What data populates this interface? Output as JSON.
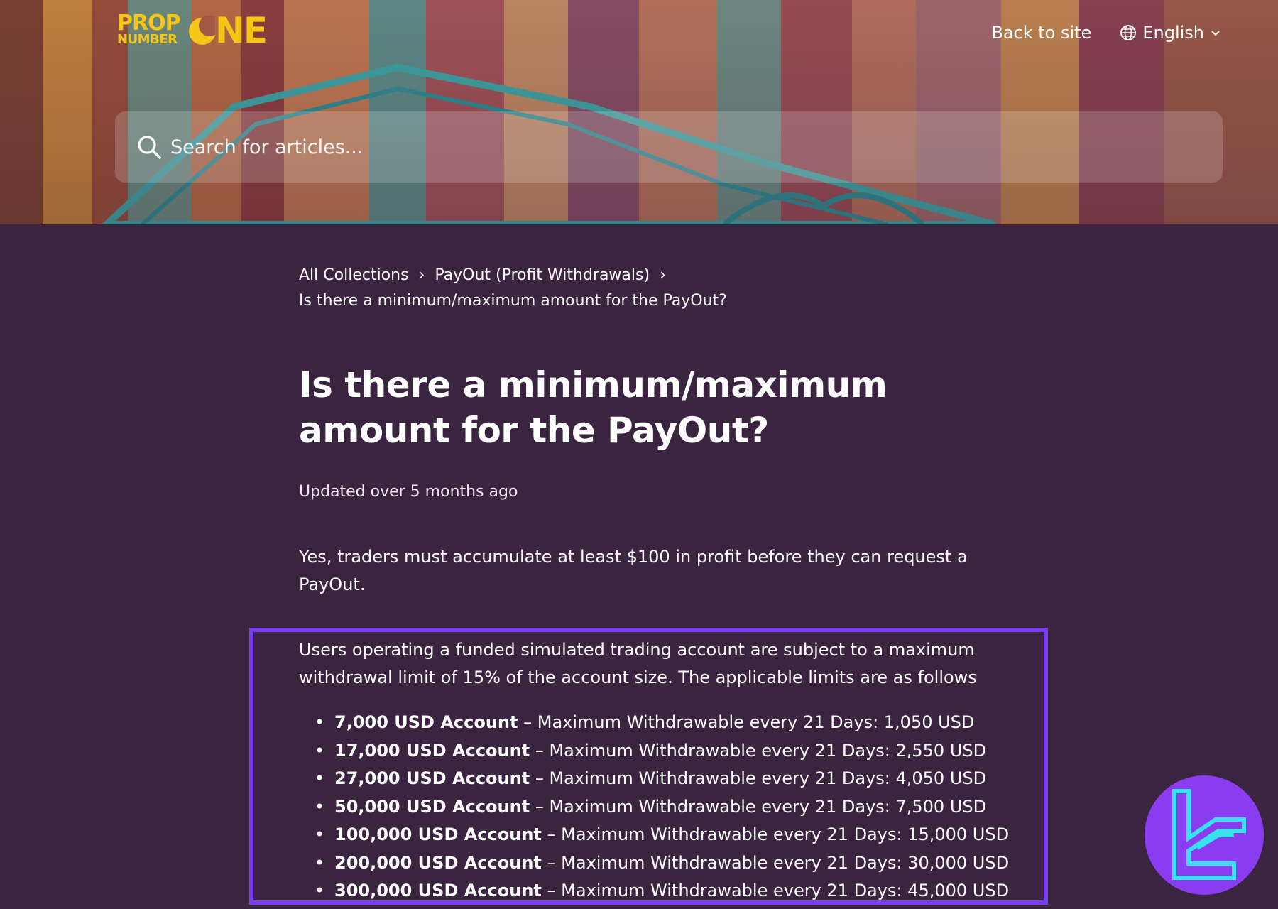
{
  "header": {
    "logo": {
      "line1": "PROP",
      "line2": "NUMBER",
      "line3": "NE"
    },
    "back_to_site": "Back to site",
    "language": "English"
  },
  "search": {
    "placeholder": "Search for articles..."
  },
  "breadcrumb": {
    "items": [
      "All Collections",
      "PayOut (Profit Withdrawals)"
    ],
    "separator": "›",
    "current": "Is there a minimum/maximum amount for the PayOut?"
  },
  "article": {
    "title": "Is there a minimum/maximum amount for the PayOut?",
    "updated": "Updated over 5 months ago",
    "intro": "Yes, traders must accumulate at least $100 in profit before they can request a PayOut.",
    "limits_intro": "Users operating a funded simulated trading account are subject to a maximum withdrawal limit of 15% of the account size. The applicable limits are as follows",
    "limits": [
      {
        "account": "7,000 USD Account",
        "detail": "– Maximum Withdrawable every 21 Days: 1,050 USD"
      },
      {
        "account": "17,000 USD Account",
        "detail": "– Maximum Withdrawable every 21 Days: 2,550 USD"
      },
      {
        "account": "27,000 USD Account",
        "detail": "– Maximum Withdrawable every 21 Days: 4,050 USD"
      },
      {
        "account": "50,000 USD Account",
        "detail": "– Maximum Withdrawable every 21 Days: 7,500 USD"
      },
      {
        "account": "100,000 USD Account",
        "detail": "– Maximum Withdrawable every 21 Days: 15,000 USD"
      },
      {
        "account": "200,000 USD Account",
        "detail": "– Maximum Withdrawable every 21 Days: 30,000 USD"
      },
      {
        "account": "300,000 USD Account",
        "detail": "– Maximum Withdrawable every 21 Days: 45,000 USD"
      }
    ]
  },
  "colors": {
    "background": "#3b2440",
    "highlight_border": "#7a3df0",
    "logo_yellow": "#f5c518",
    "badge": "#8a3df0",
    "badge_glyph": "#36e2f2"
  },
  "icons": {
    "search": "search-icon",
    "language": "globe-icon",
    "dropdown": "chevron-down-icon",
    "badge": "tc-logo-badge"
  }
}
